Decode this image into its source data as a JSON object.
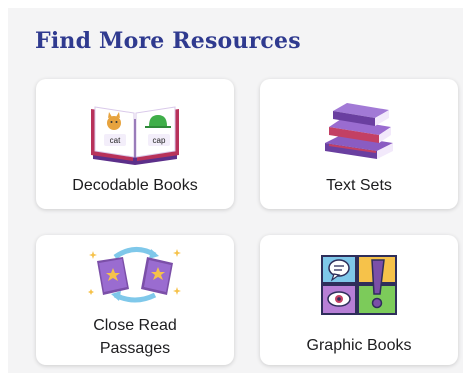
{
  "section": {
    "title": "Find More Resources"
  },
  "cards": [
    {
      "label": "Decodable Books",
      "icon": "open-book-icon",
      "book_words": [
        "cat",
        "cap"
      ]
    },
    {
      "label": "Text Sets",
      "icon": "stacked-books-icon"
    },
    {
      "label_lines": [
        "Close Read",
        "Passages"
      ],
      "icon": "star-books-cycle-icon"
    },
    {
      "label": "Graphic Books",
      "icon": "comic-panels-icon"
    }
  ],
  "colors": {
    "heading": "#2f3a8f",
    "background": "#f4f4f5",
    "card": "#ffffff",
    "book_purple": "#7b4fa8",
    "accent_yellow": "#f6c24a"
  }
}
